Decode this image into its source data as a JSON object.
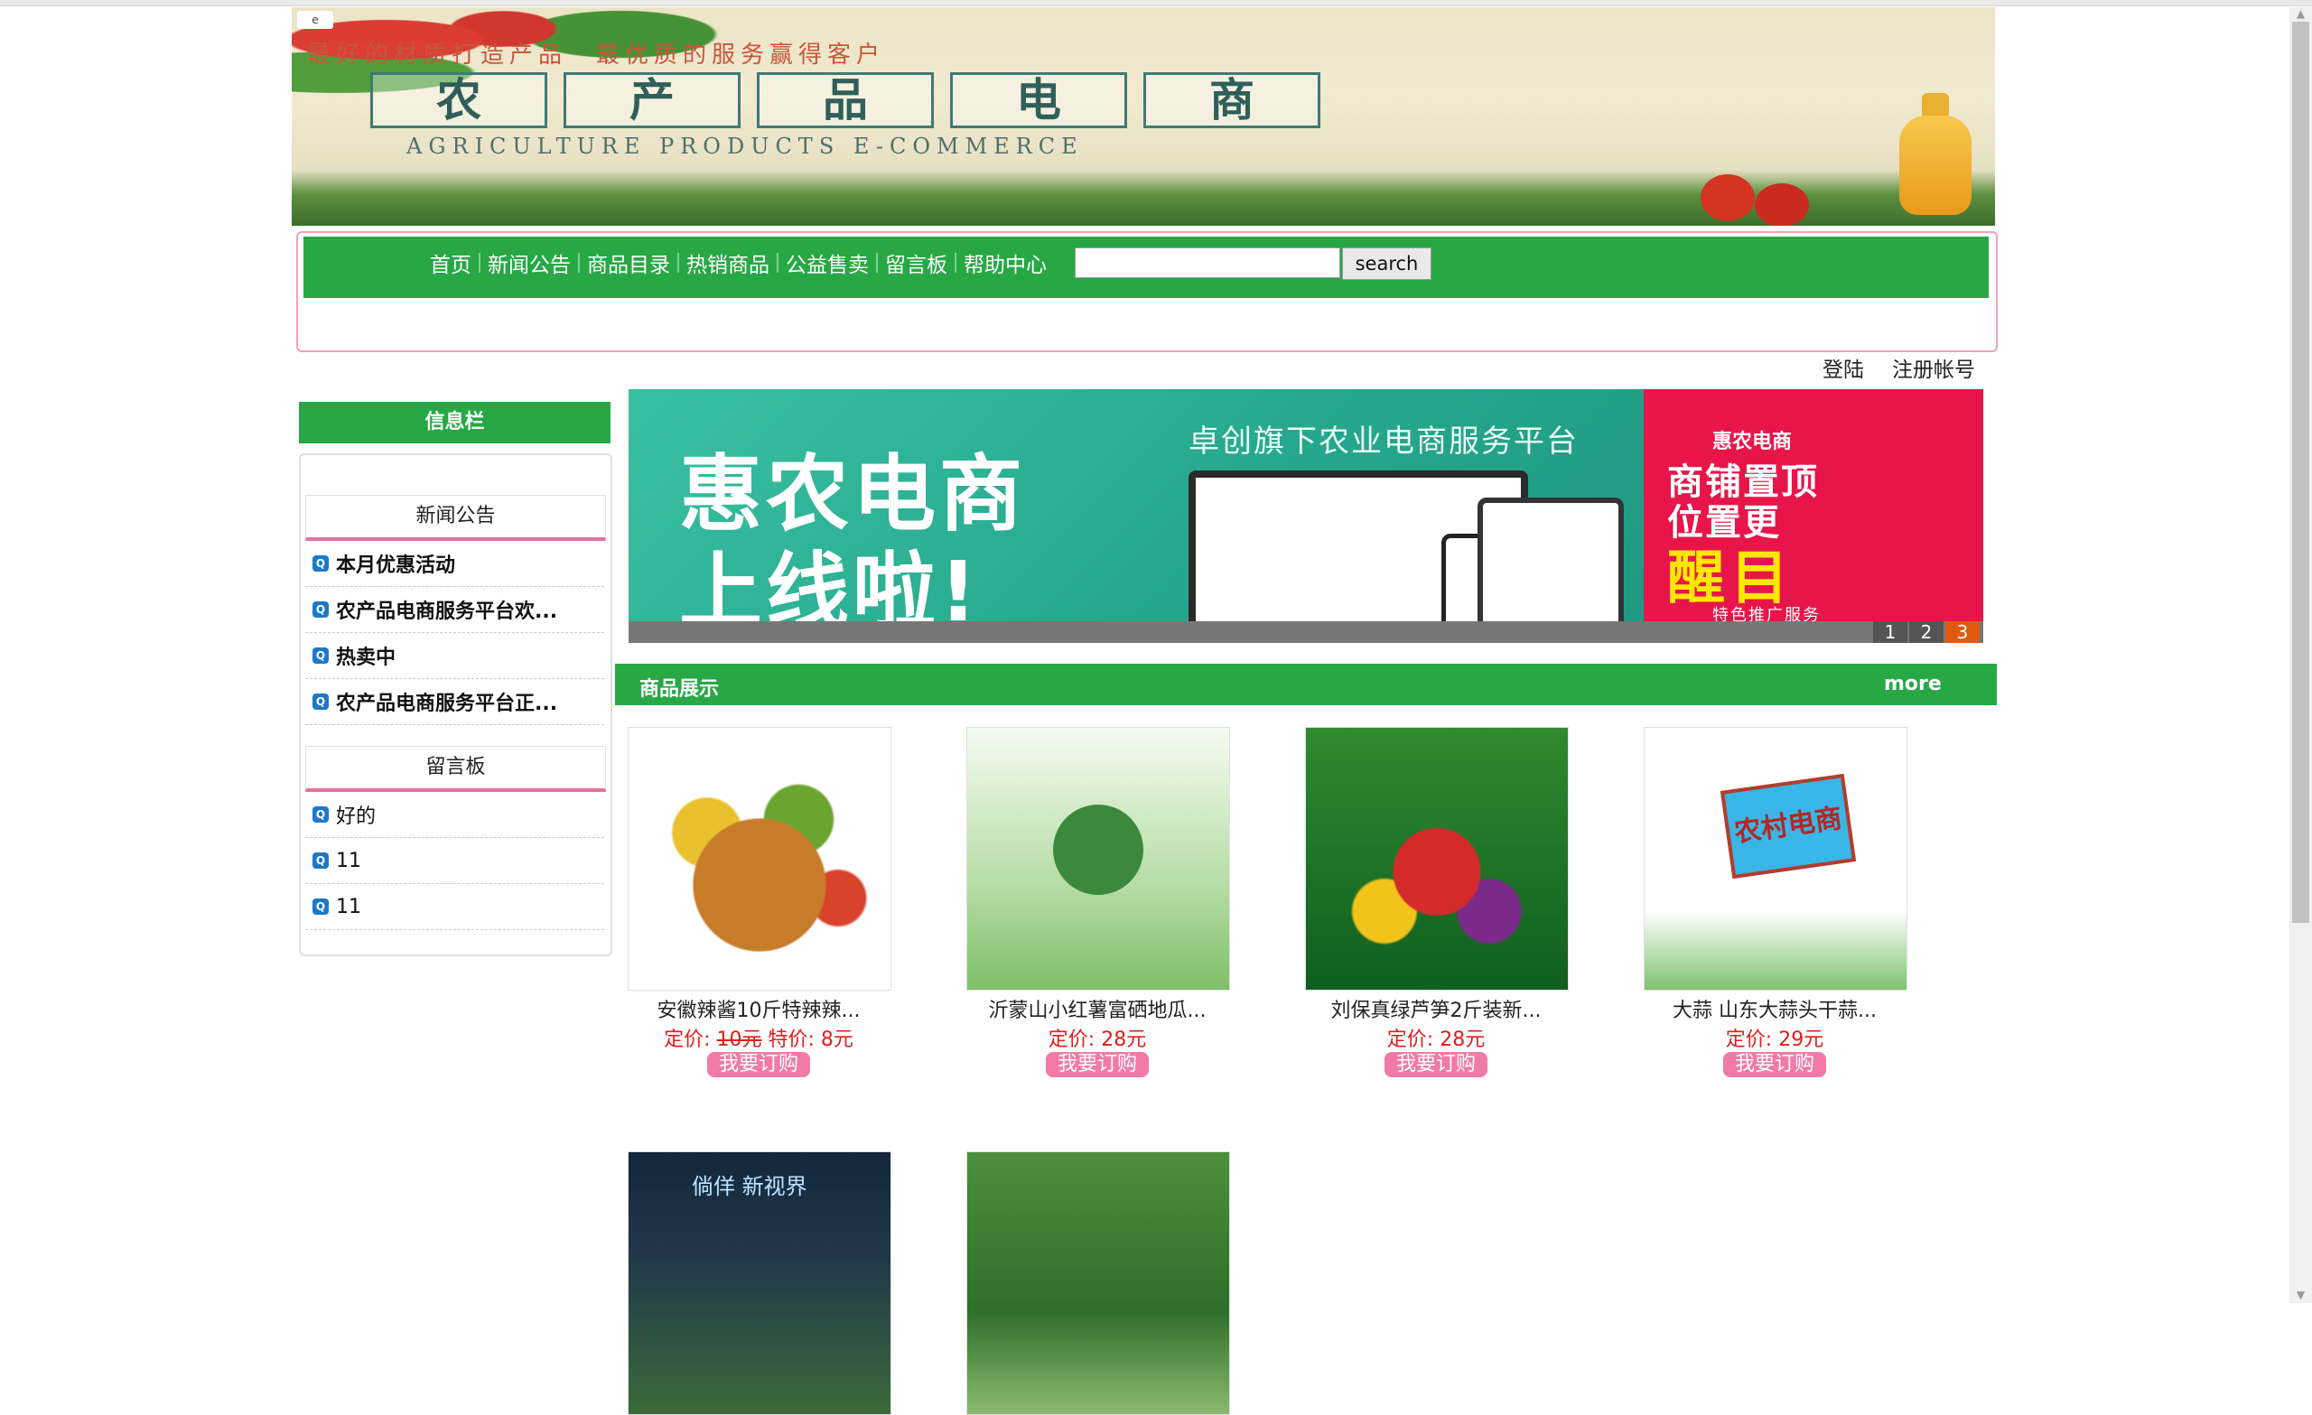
{
  "header": {
    "slogan": "最好的材质打造产品　最优质的服务赢得客户",
    "title_chars": [
      "农",
      "产",
      "品",
      "电",
      "商"
    ],
    "subtitle": "AGRICULTURE PRODUCTS E-COMMERCE"
  },
  "nav": {
    "items": [
      {
        "label": "首页"
      },
      {
        "label": "新闻公告"
      },
      {
        "label": "商品目录"
      },
      {
        "label": "热销商品"
      },
      {
        "label": "公益售卖"
      },
      {
        "label": "留言板"
      },
      {
        "label": "帮助中心"
      }
    ],
    "search_placeholder": "",
    "search_value": "",
    "search_button": "search"
  },
  "account": {
    "login": "登陆",
    "register": "注册帐号"
  },
  "sidebar": {
    "title": "信息栏",
    "news_tab": "新闻公告",
    "news": [
      {
        "text": "本月优惠活动"
      },
      {
        "text": "农产品电商服务平台欢..."
      },
      {
        "text": "热卖中"
      },
      {
        "text": "农产品电商服务平台正..."
      }
    ],
    "board_tab": "留言板",
    "board": [
      {
        "text": "好的"
      },
      {
        "text": "11"
      },
      {
        "text": "11"
      }
    ]
  },
  "carousel": {
    "line1": "惠农电商",
    "line2": "上线啦!",
    "subtitle": "卓创旗下农业电商服务平台",
    "right_brand": "惠农电商",
    "right_line1": "商铺置顶",
    "right_line2": "位置更",
    "right_line3": "醒目",
    "right_line4": "特色推广服务",
    "pages": [
      "1",
      "2",
      "3"
    ],
    "active_page": 3
  },
  "products": {
    "title": "商品展示",
    "more": "more",
    "price_label": "定价:",
    "special_label": "特价:",
    "order_button": "我要订购",
    "items": [
      {
        "name": "安徽辣酱10斤特辣辣...",
        "price": "10元",
        "special": "8元"
      },
      {
        "name": "沂蒙山小红薯富硒地瓜...",
        "price": "28元",
        "special": ""
      },
      {
        "name": "刘保真绿芦笋2斤装新...",
        "price": "28元",
        "special": ""
      },
      {
        "name": "大蒜 山东大蒜头干蒜...",
        "price": "29元",
        "special": ""
      }
    ],
    "row2_img_text": "倘佯 新视界",
    "rural_sign": "农村电商"
  },
  "colors": {
    "brand_green": "#27a845",
    "accent_pink": "#f27aa7",
    "price_red": "#e21d1d",
    "carousel_red": "#e8154a"
  }
}
